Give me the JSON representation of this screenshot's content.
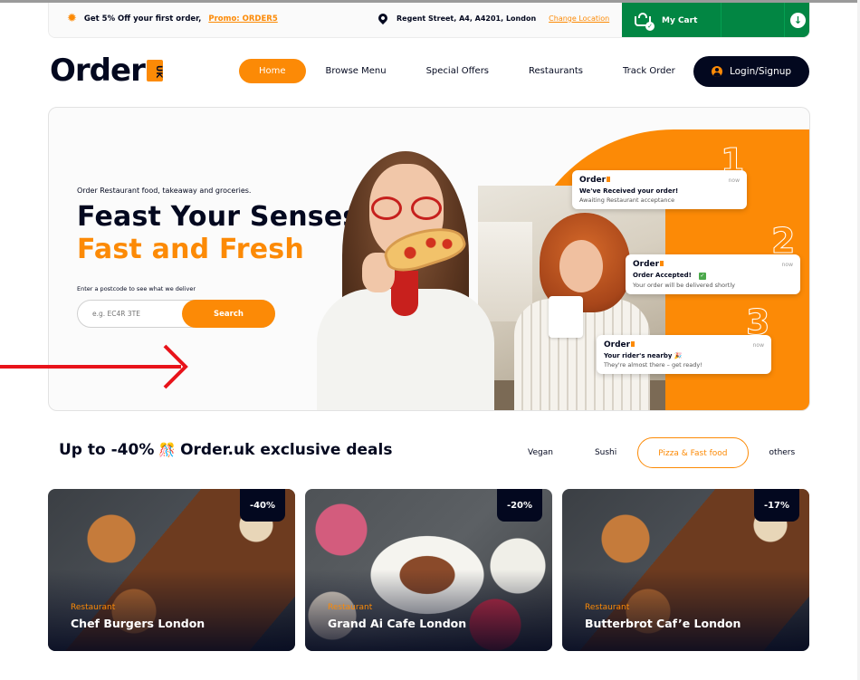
{
  "topbar": {
    "promo_text": "Get 5% Off your first order,",
    "promo_code": "Promo: ORDER5",
    "location": "Regent Street, A4, A4201, London",
    "change_location": "Change Location",
    "cart_label": "My Cart"
  },
  "nav": {
    "logo_text": "Order",
    "logo_badge": "UK",
    "items": [
      "Home",
      "Browse Menu",
      "Special Offers",
      "Restaurants",
      "Track Order"
    ],
    "login": "Login/Signup"
  },
  "hero": {
    "subtitle": "Order Restaurant food, takeaway and groceries.",
    "title_line1": "Feast Your Senses,",
    "title_line2": "Fast and Fresh",
    "postcode_hint": "Enter a postcode to see what we deliver",
    "search_placeholder": "e.g. EC4R 3TE",
    "search_button": "Search",
    "notifications": [
      {
        "step": "1",
        "logo": "Order",
        "time": "now",
        "title": "We've Received your order!",
        "text": "Awaiting Restaurant acceptance"
      },
      {
        "step": "2",
        "logo": "Order",
        "time": "now",
        "title": "Order Accepted!",
        "text": "Your order will be delivered shortly"
      },
      {
        "step": "3",
        "logo": "Order",
        "time": "now",
        "title": "Your rider's nearby 🎉",
        "text": "They're almost there – get ready!"
      }
    ]
  },
  "deals": {
    "title": "Up to -40%",
    "title_emoji": "🎊",
    "title_rest": "Order.uk exclusive deals",
    "filters": [
      "Vegan",
      "Sushi",
      "Pizza & Fast food",
      "others"
    ],
    "active_filter": "Pizza & Fast food",
    "cards": [
      {
        "discount": "-40%",
        "category": "Restaurant",
        "name": "Chef Burgers London"
      },
      {
        "discount": "-20%",
        "category": "Restaurant",
        "name": "Grand Ai Cafe London"
      },
      {
        "discount": "-17%",
        "category": "Restaurant",
        "name": "Butterbrot Caf’e London"
      }
    ]
  },
  "colors": {
    "accent": "#FC8A06",
    "dark": "#03081F",
    "cart_green": "#028643",
    "annotation_arrow": "#E8131A"
  }
}
